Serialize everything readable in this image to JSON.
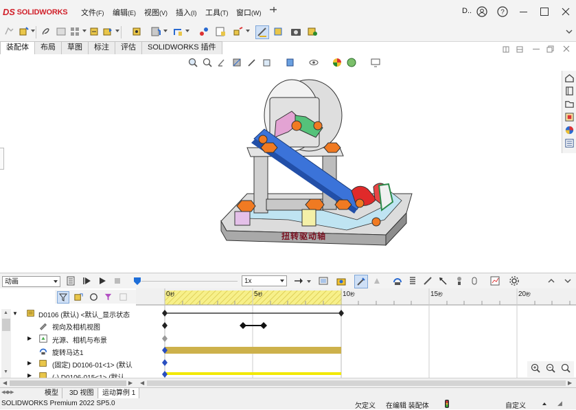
{
  "app": {
    "brand": "SOLIDWORKS",
    "brand_mark": "DS"
  },
  "menu": {
    "items": [
      {
        "label": "文件",
        "key": "(F)"
      },
      {
        "label": "编辑",
        "key": "(E)"
      },
      {
        "label": "视图",
        "key": "(V)"
      },
      {
        "label": "插入",
        "key": "(I)"
      },
      {
        "label": "工具",
        "key": "(T)"
      },
      {
        "label": "窗口",
        "key": "(W)"
      }
    ],
    "user": "D.."
  },
  "tabs": [
    "装配体",
    "布局",
    "草图",
    "标注",
    "评估",
    "SOLIDWORKS 插件"
  ],
  "model": {
    "plate_text": "扭转驱动轴"
  },
  "motion": {
    "study_type": "动画",
    "speed": "1x",
    "ruler": [
      "0",
      "5",
      "10",
      "15",
      "20"
    ],
    "ruler_unit": "秒"
  },
  "tree": {
    "root": "D0106 (默认) <默认_显示状态",
    "items": [
      "视向及相机视图",
      "光源、相机与布景",
      "旋转马达1",
      "(固定) D0106-01<1> (默认",
      "(-) D0106-015<1> (默认"
    ]
  },
  "bottom_tabs": [
    "模型",
    "3D 视图",
    "运动算例 1"
  ],
  "status": {
    "left": "SOLIDWORKS Premium 2022 SP5.0",
    "under_defined": "欠定义",
    "editing": "在编辑 装配体",
    "custom": "自定义"
  },
  "colors": {
    "brand": "#d1202a",
    "timeline_key": "#f7f08a",
    "bar_gold": "#cdb14b",
    "bar_yellow": "#f2e900",
    "accent": "#1e6ed8"
  }
}
